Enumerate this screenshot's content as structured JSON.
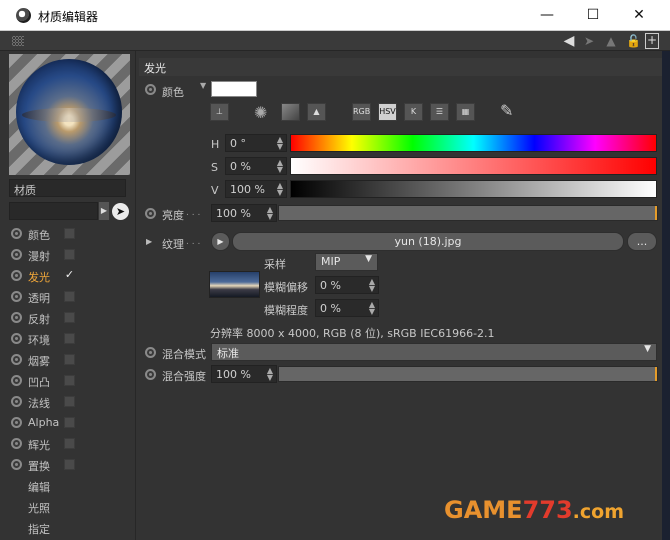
{
  "window": {
    "title": "材质编辑器",
    "minimize": "—",
    "maximize": "☐",
    "close": "✕"
  },
  "left": {
    "material_label": "材质",
    "channels": [
      {
        "label": "颜色",
        "checked": false,
        "active": false
      },
      {
        "label": "漫射",
        "checked": false,
        "active": false
      },
      {
        "label": "发光",
        "checked": true,
        "active": true
      },
      {
        "label": "透明",
        "checked": false,
        "active": false
      },
      {
        "label": "反射",
        "checked": false,
        "active": false
      },
      {
        "label": "环境",
        "checked": false,
        "active": false
      },
      {
        "label": "烟雾",
        "checked": false,
        "active": false
      },
      {
        "label": "凹凸",
        "checked": false,
        "active": false
      },
      {
        "label": "法线",
        "checked": false,
        "active": false
      },
      {
        "label": "Alpha",
        "checked": false,
        "active": false
      },
      {
        "label": "辉光",
        "checked": false,
        "active": false
      },
      {
        "label": "置换",
        "checked": false,
        "active": false
      }
    ],
    "extras": [
      "编辑",
      "光照",
      "指定"
    ]
  },
  "main": {
    "section_title": "发光",
    "color_label": "颜色",
    "mode_buttons": [
      "RGB",
      "HSV",
      "K"
    ],
    "h_label": "H",
    "h_value": "0 °",
    "s_label": "S",
    "s_value": "0 %",
    "v_label": "V",
    "v_value": "100 %",
    "brightness_label": "亮度",
    "brightness_dots": ". . .",
    "brightness_value": "100 %",
    "texture_label": "纹理",
    "texture_dots": ". . .",
    "texture_file": "yun (18).jpg",
    "texture_more": "...",
    "sampling_label": "采样",
    "sampling_value": "MIP",
    "blur_offset_label": "模糊偏移",
    "blur_offset_value": "0 %",
    "blur_degree_label": "模糊程度",
    "blur_degree_value": "0 %",
    "resolution_text": "分辨率 8000 x 4000, RGB (8 位), sRGB IEC61966-2.1",
    "blend_mode_label": "混合模式",
    "blend_mode_value": "标准",
    "blend_strength_label": "混合强度",
    "blend_strength_value": "100 %"
  },
  "watermark": {
    "part1": "GAME",
    "part2": "773",
    "part3": ".com"
  }
}
